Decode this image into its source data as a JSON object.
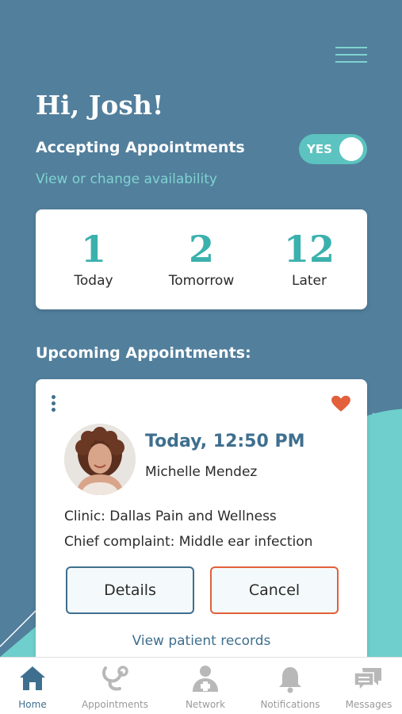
{
  "header": {
    "greeting": "Hi, Josh!",
    "accepting_label": "Accepting Appointments",
    "toggle_text": "YES",
    "availability_link": "View or change availability"
  },
  "stats": [
    {
      "value": "1",
      "label": "Today"
    },
    {
      "value": "2",
      "label": "Tomorrow"
    },
    {
      "value": "12",
      "label": "Later"
    }
  ],
  "upcoming": {
    "title": "Upcoming Appointments:",
    "appointment": {
      "time": "Today, 12:50 PM",
      "patient": "Michelle Mendez",
      "clinic": "Clinic: Dallas Pain and Wellness",
      "complaint": "Chief complaint: Middle ear infection",
      "details_label": "Details",
      "cancel_label": "Cancel",
      "records_link": "View patient records"
    }
  },
  "tabbar": {
    "items": [
      {
        "label": "Home",
        "icon": "home-icon",
        "active": true
      },
      {
        "label": "Appointments",
        "icon": "stethoscope-icon",
        "active": false
      },
      {
        "label": "Network",
        "icon": "network-icon",
        "active": false
      },
      {
        "label": "Notifications",
        "icon": "bell-icon",
        "active": false
      },
      {
        "label": "Messages",
        "icon": "chat-icon",
        "active": false
      }
    ]
  },
  "colors": {
    "background": "#527f9c",
    "accent_teal": "#5cc3c0",
    "stat_number": "#3bb1ad",
    "primary_blue": "#3f6f8e",
    "cancel_orange": "#e2603b",
    "heart": "#e2603b"
  }
}
